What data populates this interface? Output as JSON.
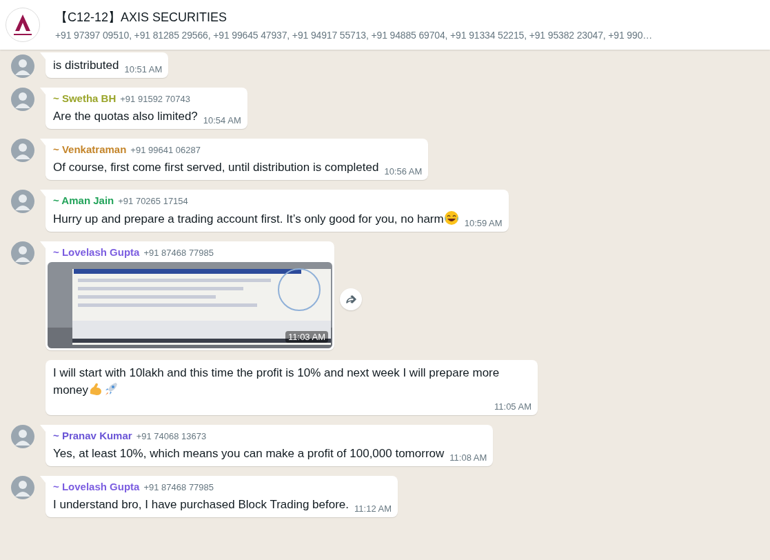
{
  "header": {
    "title": "【C12-12】AXIS SECURITIES",
    "subtitle": "+91 97397 09510, +91 81285 29566, +91 99645 47937, +91 94917 55713, +91 94885 69704, +91 91334 52215, +91 95382 23047, +91 990…"
  },
  "messages": [
    {
      "kind": "text",
      "show_avatar": true,
      "text": "is distributed",
      "time": "10:51 AM"
    },
    {
      "kind": "text",
      "show_avatar": true,
      "sender": "~ Swetha BH",
      "phone": "+91 91592 70743",
      "color": "#9aa52a",
      "text": "Are the quotas also limited?",
      "time": "10:54 AM"
    },
    {
      "kind": "text",
      "show_avatar": true,
      "sender": "~ Venkatraman",
      "phone": "+91 99641 06287",
      "color": "#c4852a",
      "text": "Of course, first come first served, until distribution is completed",
      "time": "10:56 AM"
    },
    {
      "kind": "text",
      "show_avatar": true,
      "sender": "~ Aman Jain",
      "phone": "+91 70265 17154",
      "color": "#22a35a",
      "text": "Hurry up and prepare a trading account first. It’s only good for you, no harm",
      "laugh_icon": true,
      "time": "10:59 AM"
    },
    {
      "show_avatar": true,
      "sender": "~ Lovelash Gupta",
      "phone": "+91 87468 77985",
      "color": "#7b5de0",
      "time": "11:03 AM"
    },
    {
      "kind": "text",
      "show_avatar": false,
      "text": "I will start with 10lakh  and this time the profit is 10% and next week I will prepare more money",
      "arm_icon": true,
      "rocket_icon": true,
      "time": "11:05 AM"
    },
    {
      "kind": "text",
      "show_avatar": true,
      "sender": "~ Pranav Kumar",
      "phone": "+91 74068 13673",
      "color": "#6a55d6",
      "text": "Yes, at least 10%, which means you can make a profit of 100,000 tomorrow",
      "time": "11:08 AM"
    },
    {
      "kind": "text",
      "show_avatar": true,
      "sender": "~ Lovelash Gupta",
      "phone": "+91 87468 77985",
      "color": "#7b5de0",
      "text": "I understand bro, I have purchased Block Trading before.",
      "time": "11:12 AM"
    }
  ]
}
